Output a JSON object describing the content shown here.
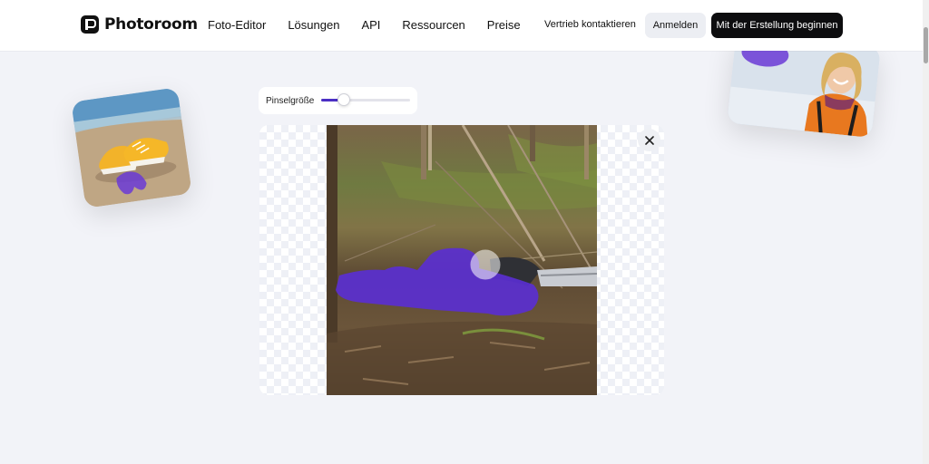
{
  "brand": {
    "name": "Photoroom"
  },
  "nav": {
    "links": [
      "Foto-Editor",
      "Lösungen",
      "API",
      "Ressourcen",
      "Preise"
    ],
    "contact": "Vertrieb kontaktieren",
    "login": "Anmelden",
    "cta": "Mit der Erstellung beginnen"
  },
  "editor": {
    "brush_label": "Pinselgröße",
    "brush_size_fraction": 0.26,
    "close_icon": "close-icon"
  },
  "colors": {
    "accent": "#4b2fc4",
    "mask": "#5a2fd0",
    "cta_bg": "#0d0d0f",
    "page_bg": "#f2f3f8"
  }
}
